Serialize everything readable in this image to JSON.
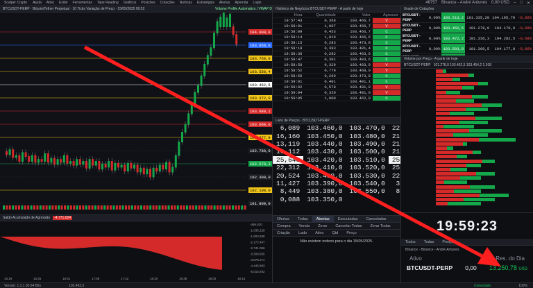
{
  "app": {
    "title": "Scalper Crypto",
    "menu": [
      "Ajuda",
      "Ativo",
      "Exibir",
      "Ferramentas",
      "Tape Reading",
      "Gráficos",
      "Posições",
      "Cotações",
      "Notícias",
      "Estratégias",
      "Alertas",
      "Aprenda",
      "Login"
    ],
    "account": "46757",
    "broker": "Binance - André Antunes",
    "balance_label": "0,00 USD"
  },
  "chart": {
    "title": "BTCUSDT-PERP · Bitcoin/Tether Perpetual · 10 Ticks Variação de Preço · 15/05/2025 09:52",
    "indicator": "Volume Profile Automatico / VWAP D",
    "price_labels": [
      {
        "text": "104.000,0",
        "color": "#d42a2a"
      },
      {
        "text": "103.860,0",
        "color": "#2b6cff"
      },
      {
        "text": "103.760,0",
        "color": "#f0c419"
      },
      {
        "text": "103.558,4",
        "color": "#f0c419"
      },
      {
        "text": "103.462,5",
        "color": "#ffffff"
      },
      {
        "text": "103.372,0",
        "color": "#f0c419"
      },
      {
        "text": "103.080,1",
        "color": "#d42a2a"
      },
      {
        "text": "103.000,0",
        "color": "#d42a2a"
      },
      {
        "text": "102.877,9",
        "color": "#f0c419"
      },
      {
        "text": "102.780,0",
        "color": "#1a1c22"
      },
      {
        "text": "102.578,3",
        "color": "#14a84b"
      },
      {
        "text": "102.300,0",
        "color": "#1a1c22"
      },
      {
        "text": "102.100,0",
        "color": "#f0c419"
      },
      {
        "text": "101.800,0",
        "color": "#1a1c22"
      }
    ]
  },
  "sub": {
    "title": "Saldo Acumulado de Agressão",
    "value_badge": "-4.771.024",
    "axis": [
      "-466.620",
      "-1.035.229",
      "-1.603.838",
      "-2.172.447",
      "-2.741.056",
      "-3.309.665",
      "-3.878.274",
      "-4.446.883",
      "-5.015.492"
    ],
    "times": [
      "16:19",
      "16:25",
      "16:51",
      "17:08",
      "17:42",
      "18:20",
      "18:38",
      "19:00",
      "19:14"
    ]
  },
  "trades": {
    "title": "Histórico de Negócios BTCUSDT-PERP - A partir de hoje",
    "headers": [
      "Hora",
      "Quantidade",
      "Valor",
      "Agressor"
    ],
    "rows": [
      {
        "time": "19:57:43",
        "qty": "0,368",
        "price": "103.466,7",
        "side": "V"
      },
      {
        "time": "19:58:01",
        "qty": "1,007",
        "price": "103.466,7",
        "side": "V"
      },
      {
        "time": "19:58:09",
        "qty": "0,453",
        "price": "103.466,7",
        "side": "C"
      },
      {
        "time": "19:58:14",
        "qty": "1,019",
        "price": "103.466,6",
        "side": "C"
      },
      {
        "time": "19:58:15",
        "qty": "0,283",
        "price": "103.473,8",
        "side": "C"
      },
      {
        "time": "19:58:18",
        "qty": "0,393",
        "price": "103.481,4",
        "side": "C"
      },
      {
        "time": "19:58:36",
        "qty": "0,282",
        "price": "103.483,6",
        "side": "C"
      },
      {
        "time": "19:58:47",
        "qty": "0,301",
        "price": "103.483,6",
        "side": "C"
      },
      {
        "time": "19:58:50",
        "qty": "0,329",
        "price": "103.483,9",
        "side": "V"
      },
      {
        "time": "19:58:52",
        "qty": "0,779",
        "price": "103.468,0",
        "side": "V"
      },
      {
        "time": "19:58:56",
        "qty": "0,269",
        "price": "103.473,8",
        "side": "C"
      },
      {
        "time": "19:59:01",
        "qty": "0,401",
        "price": "103.481,1",
        "side": "C"
      },
      {
        "time": "19:59:02",
        "qty": "0,578",
        "price": "103.481,9",
        "side": "V"
      },
      {
        "time": "19:59:04",
        "qty": "0,320",
        "price": "103.481,9",
        "side": "V"
      },
      {
        "time": "19:59:05",
        "qty": "1,000",
        "price": "103.462,0",
        "side": "C"
      }
    ]
  },
  "book": {
    "title": "Livro de Preços · BTCUSDT-PERP",
    "rows": [
      [
        "6,089",
        "103.460,0",
        "103.470,0",
        "22,147"
      ],
      [
        "16,160",
        "103.450,0",
        "103.480,0",
        "21,187"
      ],
      [
        "13,119",
        "103.440,0",
        "103.490,0",
        "21,157"
      ],
      [
        "16,112",
        "103.430,0",
        "103.500,0",
        "21,258"
      ],
      [
        "25,648",
        "103.420,0",
        "103.510,0",
        "25,025"
      ],
      [
        "22,312",
        "103.410,0",
        "103.520,0",
        "25,503"
      ],
      [
        "20,524",
        "103.400,0",
        "103.530,0",
        "22,857"
      ],
      [
        "11,427",
        "103.390,0",
        "103.540,0",
        "3,665"
      ],
      [
        "8,449",
        "103.380,0",
        "103.550,0",
        "8,619"
      ],
      [
        "0,088",
        "103.350,0",
        "",
        ""
      ]
    ]
  },
  "orders": {
    "tabs": [
      "Ofertas",
      "Todas",
      "Abertas",
      "Executadas",
      "Canceladas"
    ],
    "active_tab": "Abertas",
    "columns": [
      "Compra",
      "Venda",
      "Zerar",
      "Cancelar Todas",
      "Zerar Todas"
    ],
    "subcolumns": [
      "Criação",
      "Lado",
      "Ativo",
      "Qtd",
      "Preço"
    ],
    "empty": "Não existem ordens para o dia 15/05/2025."
  },
  "quotes": {
    "title": "Grade de Cotações",
    "rows": [
      {
        "sym": "BTCUSDT-PERP",
        "a": "0,00%",
        "b": "103.513,2",
        "c": "101.335,20",
        "d": "104.195,70",
        "e": "-0,66%"
      },
      {
        "sym": "BTCUSDT-PERP",
        "a": "0,00%",
        "b": "103.462,5",
        "c": "101.278,0",
        "d": "104.170,0",
        "e": "-0,69%"
      },
      {
        "sym": "BTCUSDT-PERP",
        "a": "0,00%",
        "b": "103.472,2",
        "c": "101.336,3",
        "d": "104.282,5",
        "e": "-0,68%"
      },
      {
        "sym": "BTCUSDT-PERP",
        "a": "0,00%",
        "b": "103.503,0",
        "c": "101.360,5",
        "d": "104.177,8",
        "e": "-0,66%"
      },
      {
        "sym": "BTCUSDT-PERP",
        "a": "0,00%",
        "b": "103.476,3",
        "c": "101.341,6",
        "d": "104.210,8",
        "e": "-0,68%"
      }
    ]
  },
  "vap": {
    "title": "Volume por Preço - A partir de hoje",
    "header": "BTCUSDT-PERP",
    "stats": "101.278,0   103.462,5   103.454,2   1.918"
  },
  "clock": {
    "time": "19:59:23",
    "tabs": [
      "Todos",
      "Todas",
      "Posição"
    ],
    "symbol": "BTCUSDT-PERP",
    "qty": "0,00",
    "pnl_label": "Res. do Dia",
    "pnl": "13.250,78",
    "currency": "USD",
    "asset_label": "Ativo",
    "broker_line": "Binance · Binance - André Antunes"
  },
  "status": {
    "version": "Versão: 1.3.1.30 64 Bits",
    "price": "103.462,5",
    "conn": "Conectado",
    "zoom": "100%"
  },
  "colors": {
    "buy": "#14a84b",
    "sell": "#d42a2a",
    "arrow": "#ff1f1f"
  }
}
